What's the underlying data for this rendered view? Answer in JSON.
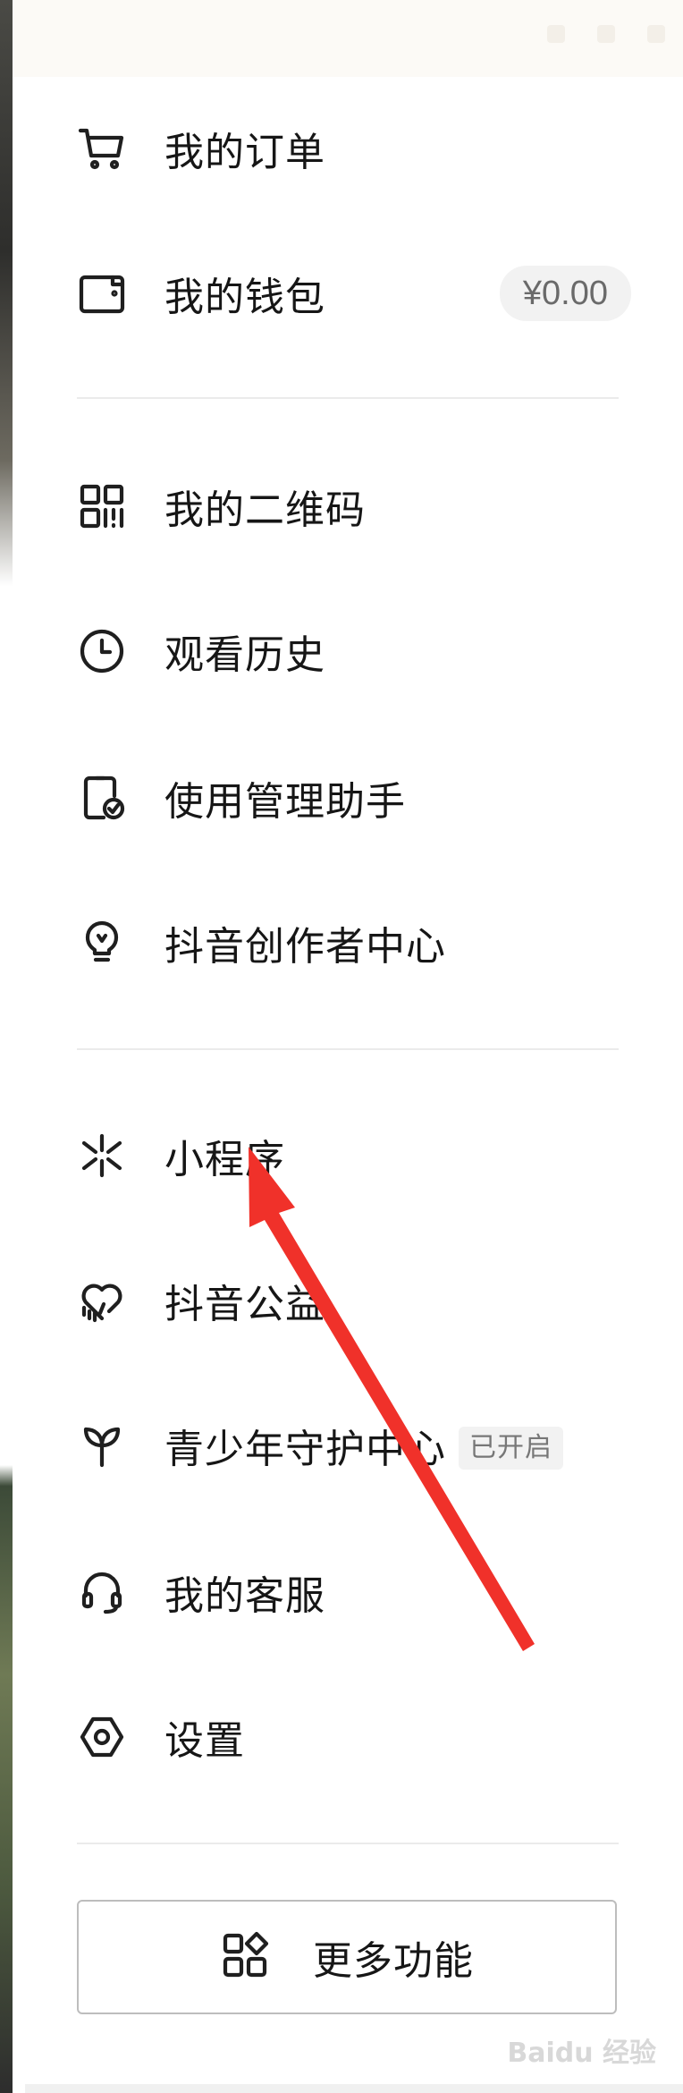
{
  "menu": {
    "items": [
      {
        "label": "我的订单",
        "icon": "cart-icon"
      },
      {
        "label": "我的钱包",
        "icon": "wallet-icon",
        "badge": "¥0.00"
      },
      {
        "label": "我的二维码",
        "icon": "qrcode-icon"
      },
      {
        "label": "观看历史",
        "icon": "clock-icon"
      },
      {
        "label": "使用管理助手",
        "icon": "phone-check-icon"
      },
      {
        "label": "抖音创作者中心",
        "icon": "lightbulb-icon"
      },
      {
        "label": "小程序",
        "icon": "mini-program-icon"
      },
      {
        "label": "抖音公益",
        "icon": "heart-hand-icon"
      },
      {
        "label": "青少年守护中心",
        "icon": "sprout-icon",
        "tag": "已开启"
      },
      {
        "label": "我的客服",
        "icon": "headset-icon"
      },
      {
        "label": "设置",
        "icon": "hexagon-settings-icon"
      }
    ]
  },
  "more_button": {
    "label": "更多功能",
    "icon": "grid-shapes-icon"
  },
  "watermark": "Baidu 经验",
  "annotation": {
    "color": "#f0312a"
  }
}
